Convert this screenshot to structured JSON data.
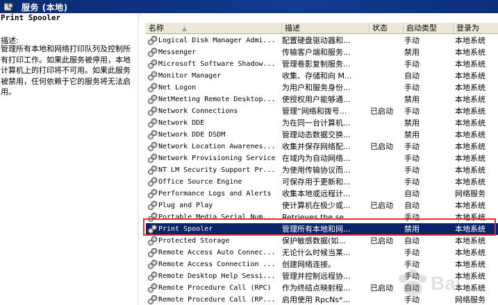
{
  "window": {
    "title": "服务 (本地)",
    "title_icon": "services-gear-icon"
  },
  "left_pane": {
    "service_name": "Print Spooler",
    "description_label": "描述:",
    "description": "管理所有本地和网络打印队列及控制所有打印工作。如果此服务被停用，本地计算机上的打印将不可用。如果此服务被禁用，任何依赖于它的服务将无法启用。"
  },
  "columns": [
    {
      "key": "name",
      "label": "名称"
    },
    {
      "key": "desc",
      "label": "描述"
    },
    {
      "key": "status",
      "label": "状态"
    },
    {
      "key": "startup",
      "label": "启动类型"
    },
    {
      "key": "logon",
      "label": "登录为"
    }
  ],
  "sort_indicator": "▲",
  "rows": [
    {
      "name": "Logical Disk Manager Admi...",
      "desc": "配置硬盘驱动器和...",
      "status": "",
      "startup": "手动",
      "logon": "本地系统"
    },
    {
      "name": "Messenger",
      "desc": "传输客户端和服务...",
      "status": "",
      "startup": "禁用",
      "logon": "本地系统"
    },
    {
      "name": "Microsoft Software Shadow...",
      "desc": "管理卷影复制服务...",
      "status": "",
      "startup": "手动",
      "logon": "本地系统"
    },
    {
      "name": "Monitor Manager",
      "desc": "收集、存储和向 M...",
      "status": "",
      "startup": "自动",
      "logon": "本地系统"
    },
    {
      "name": "Net Logon",
      "desc": "为用户和服务身份...",
      "status": "",
      "startup": "手动",
      "logon": "本地系统"
    },
    {
      "name": "NetMeeting Remote Desktop...",
      "desc": "使授权用户能够通...",
      "status": "",
      "startup": "禁用",
      "logon": "本地系统"
    },
    {
      "name": "Network Connections",
      "desc": "管理“网络和拨号...",
      "status": "已启动",
      "startup": "手动",
      "logon": "本地系统"
    },
    {
      "name": "Network DDE",
      "desc": "为在同一台计算机...",
      "status": "",
      "startup": "禁用",
      "logon": "本地系统"
    },
    {
      "name": "Network DDE DSDM",
      "desc": "管理动态数据交换...",
      "status": "",
      "startup": "禁用",
      "logon": "本地系统"
    },
    {
      "name": "Network Location Awarenes...",
      "desc": "收集并保存网络配...",
      "status": "已启动",
      "startup": "手动",
      "logon": "本地系统"
    },
    {
      "name": "Network Provisioning Service",
      "desc": "在域内为自动网络...",
      "status": "",
      "startup": "手动",
      "logon": "本地系统"
    },
    {
      "name": "NT LM Security Support Pr...",
      "desc": "为使用传输协议而...",
      "status": "",
      "startup": "手动",
      "logon": "本地系统"
    },
    {
      "name": "Office Source Engine",
      "desc": "可保存用于更新和...",
      "status": "",
      "startup": "手动",
      "logon": "本地系统"
    },
    {
      "name": "Performance Logs and Alerts",
      "desc": "收集本地或远程计...",
      "status": "",
      "startup": "自动",
      "logon": "网络服务"
    },
    {
      "name": "Plug and Play",
      "desc": "使计算机在极少或...",
      "status": "已启动",
      "startup": "自动",
      "logon": "本地系统"
    },
    {
      "name": "Portable Media Serial Num...",
      "desc": "Retrieves the se...",
      "status": "",
      "startup": "手动",
      "logon": "本地系统"
    },
    {
      "name": "Print Spooler",
      "desc": "管理所有本地和网...",
      "status": "",
      "startup": "禁用",
      "logon": "本地系统",
      "selected": true
    },
    {
      "name": "Protected Storage",
      "desc": "保护敏感数据(如...",
      "status": "已启动",
      "startup": "自动",
      "logon": "本地系统"
    },
    {
      "name": "Remote Access Auto Connec...",
      "desc": "无论什么时候当某...",
      "status": "",
      "startup": "手动",
      "logon": "本地系统"
    },
    {
      "name": "Remote Access Connection ...",
      "desc": "创建网络连接。",
      "status": "",
      "startup": "手动",
      "logon": "本地系统"
    },
    {
      "name": "Remote Desktop Help Sessi...",
      "desc": "管理并控制远程协...",
      "status": "",
      "startup": "手动",
      "logon": "本地系统"
    },
    {
      "name": "Remote Procedure Call (RPC)",
      "desc": "作为终结点映射程...",
      "status": "已启动",
      "startup": "自动",
      "logon": "本地系统"
    },
    {
      "name": "Remote Procedure Call (RP...",
      "desc": "启用使用 RpcNs*...",
      "status": "",
      "startup": "手动",
      "logon": "网络服务"
    }
  ],
  "colors": {
    "title_bar": "#0a2a73",
    "selection": "#0a246a",
    "highlight_box": "#e0312a"
  },
  "row_icon": "service-gear-icon"
}
